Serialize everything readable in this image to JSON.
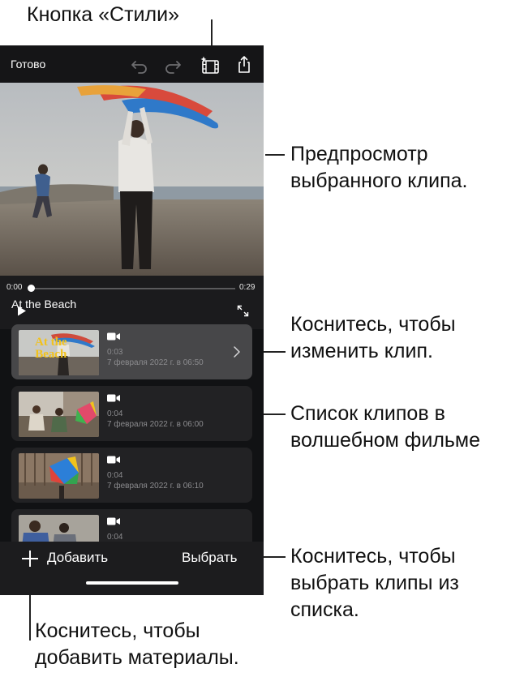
{
  "callouts": {
    "styles_button": "Кнопка «Стили»",
    "preview_line1": "Предпросмотр",
    "preview_line2": "выбранного клипа.",
    "edit_line1": "Коснитесь, чтобы",
    "edit_line2": "изменить клип.",
    "list_line1": "Список клипов в",
    "list_line2": "волшебном фильме",
    "select_line1": "Коснитесь, чтобы",
    "select_line2": "выбрать клипы из",
    "select_line3": "списка.",
    "add_line1": "Коснитесь, чтобы",
    "add_line2": "добавить материалы."
  },
  "toolbar": {
    "done_label": "Готово",
    "icons": [
      "undo-icon",
      "redo-icon",
      "styles-icon",
      "share-icon"
    ]
  },
  "player": {
    "time_start": "0:00",
    "time_end": "0:29",
    "progress": 0,
    "icons": [
      "play-icon",
      "fullscreen-icon"
    ]
  },
  "project": {
    "title": "At the Beach",
    "thumb_title_line1": "At the",
    "thumb_title_line2": "Beach"
  },
  "clips": [
    {
      "duration": "0:03",
      "date": "7 февраля 2022 г. в 06:50",
      "selected": true
    },
    {
      "duration": "0:04",
      "date": "7 февраля 2022 г. в 06:00",
      "selected": false
    },
    {
      "duration": "0:04",
      "date": "7 февраля 2022 г. в 06:10",
      "selected": false
    },
    {
      "duration": "0:04",
      "date": "",
      "selected": false
    }
  ],
  "bottom": {
    "add_label": "Добавить",
    "select_label": "Выбрать"
  },
  "colors": {
    "app_background": "#111214",
    "clip_card": "#222224",
    "clip_card_selected": "#474749",
    "title_yellow": "#f2c21b"
  }
}
